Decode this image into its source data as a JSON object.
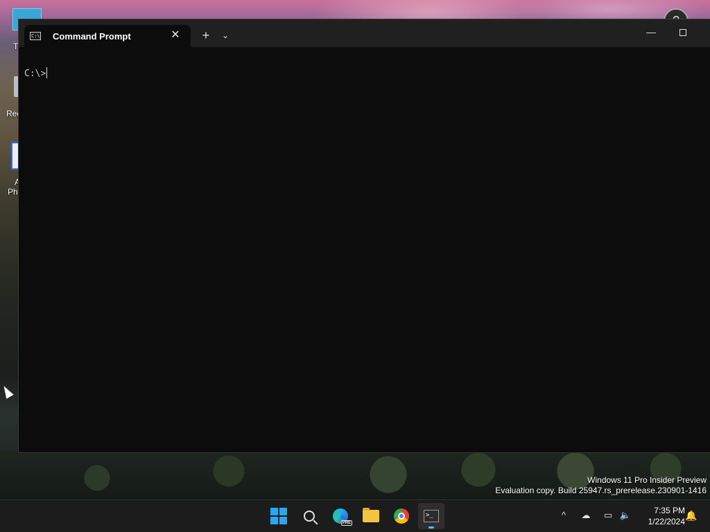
{
  "desktop": {
    "icon_labels": [
      "T",
      "Rec",
      "A",
      "Ph"
    ]
  },
  "window": {
    "tab_title": "Command Prompt",
    "tab_close_glyph": "✕",
    "new_tab_glyph": "+",
    "tab_menu_glyph": "⌄",
    "minimize_glyph": "—",
    "prompt": "C:\\>"
  },
  "watermark": {
    "line1": "Windows 11 Pro Insider Preview",
    "line2": "Evaluation copy. Build 25947.rs_prerelease.230901-1416"
  },
  "taskbar": {
    "edge_badge": "PRE",
    "terminal_glyph": ">_",
    "time": "7:35 PM",
    "date": "1/22/2024",
    "tray_chevron": "^",
    "accent": "#4cc2ff"
  }
}
